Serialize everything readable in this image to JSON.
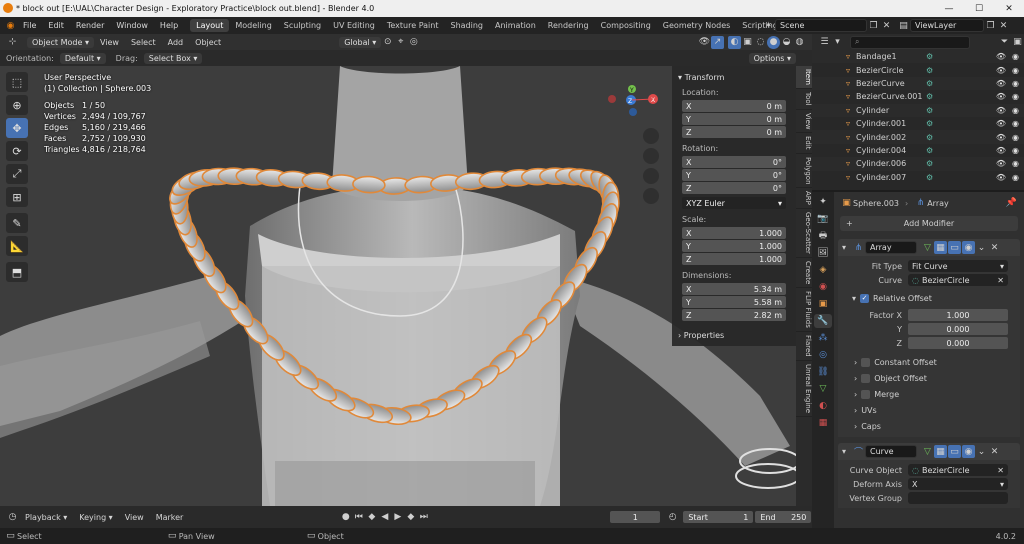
{
  "window": {
    "title": "* block out [E:\\UAL\\Character Design - Exploratory Practice\\block out.blend] - Blender 4.0"
  },
  "menu": {
    "items": [
      "File",
      "Edit",
      "Render",
      "Window",
      "Help"
    ]
  },
  "workspaces": [
    "Layout",
    "Modeling",
    "Sculpting",
    "UV Editing",
    "Texture Paint",
    "Shading",
    "Animation",
    "Rendering",
    "Compositing",
    "Geometry Nodes",
    "Scripting"
  ],
  "scene": {
    "name": "Scene",
    "view_layer": "ViewLayer"
  },
  "header": {
    "mode": "Object Mode",
    "menus": [
      "View",
      "Select",
      "Add",
      "Object"
    ],
    "orientation_label": "Orientation:",
    "orientation_value": "Default",
    "drag_label": "Drag:",
    "drag_value": "Select Box",
    "transform_orientation": "Global",
    "options": "Options"
  },
  "viewport": {
    "view_name": "User Perspective",
    "collection": "(1) Collection | Sphere.003",
    "stats": [
      {
        "k": "Objects",
        "v": "1 / 50"
      },
      {
        "k": "Vertices",
        "v": "2,494 / 109,767"
      },
      {
        "k": "Edges",
        "v": "5,160 / 219,466"
      },
      {
        "k": "Faces",
        "v": "2,752 / 109,930"
      },
      {
        "k": "Triangles",
        "v": "4,816 / 218,764"
      }
    ],
    "gizmo": {
      "x": "X",
      "y": "Y",
      "z": "Z"
    }
  },
  "npanel": {
    "title": "Transform",
    "location_label": "Location:",
    "location": [
      {
        "k": "X",
        "v": "0 m"
      },
      {
        "k": "Y",
        "v": "0 m"
      },
      {
        "k": "Z",
        "v": "0 m"
      }
    ],
    "rotation_label": "Rotation:",
    "rotation": [
      {
        "k": "X",
        "v": "0°"
      },
      {
        "k": "Y",
        "v": "0°"
      },
      {
        "k": "Z",
        "v": "0°"
      }
    ],
    "rotation_mode": "XYZ Euler",
    "scale_label": "Scale:",
    "scale": [
      {
        "k": "X",
        "v": "1.000"
      },
      {
        "k": "Y",
        "v": "1.000"
      },
      {
        "k": "Z",
        "v": "1.000"
      }
    ],
    "dimensions_label": "Dimensions:",
    "dimensions": [
      {
        "k": "X",
        "v": "5.34 m"
      },
      {
        "k": "Y",
        "v": "5.58 m"
      },
      {
        "k": "Z",
        "v": "2.82 m"
      }
    ],
    "properties": "Properties",
    "tabs": [
      "Item",
      "Tool",
      "View",
      "Edit",
      "Polygon",
      "ARP",
      "Geo-Scatter",
      "Create",
      "FLIP Fluids",
      "Flared",
      "Unreal Engine"
    ]
  },
  "timeline": {
    "menus": [
      "Playback",
      "Keying",
      "View",
      "Marker"
    ],
    "current_frame": "1",
    "start_label": "Start",
    "start": "1",
    "end_label": "End",
    "end": "250"
  },
  "statusbar": {
    "select": "Select",
    "pan": "Pan View",
    "object": "Object",
    "version": "4.0.2"
  },
  "outliner": {
    "items": [
      {
        "name": "Bandage1",
        "extra": ""
      },
      {
        "name": "BezierCircle",
        "extra": ""
      },
      {
        "name": "BezierCurve",
        "extra": ""
      },
      {
        "name": "BezierCurve.001",
        "extra": ""
      },
      {
        "name": "Cylinder",
        "extra": ""
      },
      {
        "name": "Cylinder.001",
        "extra": ""
      },
      {
        "name": "Cylinder.002",
        "extra": ""
      },
      {
        "name": "Cylinder.004",
        "extra": ""
      },
      {
        "name": "Cylinder.006",
        "extra": ""
      },
      {
        "name": "Cylinder.007",
        "extra": ""
      }
    ]
  },
  "properties": {
    "object": "Sphere.003",
    "modifiers_label": "Array",
    "add_modifier": "Add Modifier",
    "array": {
      "name": "Array",
      "fit_type_label": "Fit Type",
      "fit_type": "Fit Curve",
      "curve_label": "Curve",
      "curve": "BezierCircle",
      "relative_offset": "Relative Offset",
      "factor_x_label": "Factor X",
      "factor_x": "1.000",
      "factor_y_label": "Y",
      "factor_y": "0.000",
      "factor_z_label": "Z",
      "factor_z": "0.000",
      "constant_offset": "Constant Offset",
      "object_offset": "Object Offset",
      "merge": "Merge",
      "uvs": "UVs",
      "caps": "Caps"
    },
    "curve_mod": {
      "name": "Curve",
      "curve_object_label": "Curve Object",
      "curve_object": "BezierCircle",
      "deform_axis_label": "Deform Axis",
      "deform_axis": "X",
      "vertex_group_label": "Vertex Group"
    }
  },
  "colors": {
    "accent": "#4772b3",
    "selected_outline": "#e0893a",
    "viewport_bg": "#3d3d3d"
  }
}
